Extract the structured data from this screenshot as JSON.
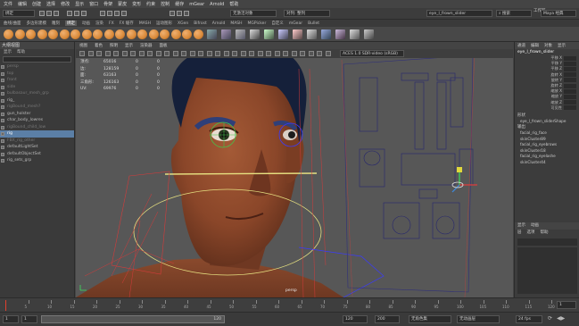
{
  "menubar": {
    "items": [
      "文件",
      "编辑",
      "创建",
      "选择",
      "修改",
      "显示",
      "窗口",
      "骨架",
      "蒙皮",
      "变形",
      "约束",
      "控制",
      "缓存",
      "mGear",
      "Arnold",
      "帮助"
    ],
    "workspace_label": "工作区",
    "workspace_value": "Maya 经典"
  },
  "status": {
    "mode": "绑定",
    "search_placeholder": "无激活对象",
    "input_label": "对列: 整列",
    "name_field": "eye_l_frown_slider",
    "search_label": "搜索"
  },
  "shelf": {
    "tabs": [
      "曲线/曲面",
      "多边形建模",
      "雕刻",
      "绑定",
      "动画",
      "渲染",
      "FX",
      "FX 缓存",
      "MASH",
      "运动图形",
      "XGen",
      "Bifrost",
      "Arnold",
      "MASH",
      "MGPicker",
      "自定义",
      "mGear",
      "Bullet"
    ],
    "active_tab": "绑定"
  },
  "outliner": {
    "title": "大纲视图",
    "menu": [
      "显示",
      "帮助"
    ],
    "items": [
      {
        "label": "persp",
        "state": "dim"
      },
      {
        "label": "top",
        "state": "dim"
      },
      {
        "label": "front",
        "state": "dim"
      },
      {
        "label": "side",
        "state": "dim"
      },
      {
        "label": "bulbasaur_mesh_grp",
        "state": "dim"
      },
      {
        "label": "rig_",
        "state": "normal"
      },
      {
        "label": "rigBound_mesh?",
        "state": "dim"
      },
      {
        "label": "gun_holster",
        "state": "normal"
      },
      {
        "label": "char_body_lowres",
        "state": "normal"
      },
      {
        "label": "rigBound_child_low",
        "state": "dim"
      },
      {
        "label": "rig",
        "state": "selected"
      },
      {
        "label": "FBX_rig_other",
        "state": "dim"
      },
      {
        "label": "defaultLightSet",
        "state": "normal"
      },
      {
        "label": "defaultObjectSet",
        "state": "normal"
      },
      {
        "label": "rig_sets_grp",
        "state": "normal"
      }
    ]
  },
  "viewport": {
    "menu": [
      "视图",
      "着色",
      "照明",
      "显示",
      "渲染器",
      "面板"
    ],
    "colorspace": "ACES 1.0 SDR-video (sRGB)",
    "camera": "persp",
    "hud": [
      {
        "k": "顶点:",
        "v": "65016",
        "w": "0",
        "x": "0"
      },
      {
        "k": "边:",
        "v": "128159",
        "w": "0",
        "x": "0"
      },
      {
        "k": "面:",
        "v": "63163",
        "w": "0",
        "x": "0"
      },
      {
        "k": "三角形:",
        "v": "126163",
        "w": "0",
        "x": "0"
      },
      {
        "k": "UV:",
        "v": "69976",
        "w": "0",
        "x": "0"
      }
    ]
  },
  "channelbox": {
    "tabs": [
      "通道",
      "编辑",
      "对象",
      "显示"
    ],
    "node": "eye_l_frown_slider",
    "attrs": [
      "平移 X",
      "平移 Y",
      "平移 Z",
      "旋转 X",
      "旋转 Y",
      "旋转 Z",
      "缩放 X",
      "缩放 Y",
      "缩放 Z",
      "可见性"
    ],
    "shapes_title": "形状",
    "shape": "eye_l_frown_sliderShape",
    "outputs_title": "输出",
    "outputs": [
      "facial_rig_face",
      "skinCluster89",
      "facial_rig_eyebrows",
      "skinCluster18",
      "facial_rig_eyelashe",
      "skinCluster44"
    ],
    "layer_tabs": [
      "显示",
      "动画"
    ],
    "layer_menu": [
      "层",
      "选项",
      "帮助"
    ]
  },
  "timeline": {
    "ticks": [
      "5",
      "10",
      "15",
      "20",
      "25",
      "30",
      "35",
      "40",
      "45",
      "50",
      "55",
      "60",
      "65",
      "70",
      "75",
      "80",
      "85",
      "90",
      "95",
      "100",
      "105",
      "110",
      "115",
      "120"
    ],
    "current": "1"
  },
  "range": {
    "start": "1",
    "start2": "1",
    "current": "120",
    "end": "120",
    "end2": "200",
    "char_set": "无角色集",
    "anim_layer": "无动画层",
    "fps": "24 fps"
  }
}
